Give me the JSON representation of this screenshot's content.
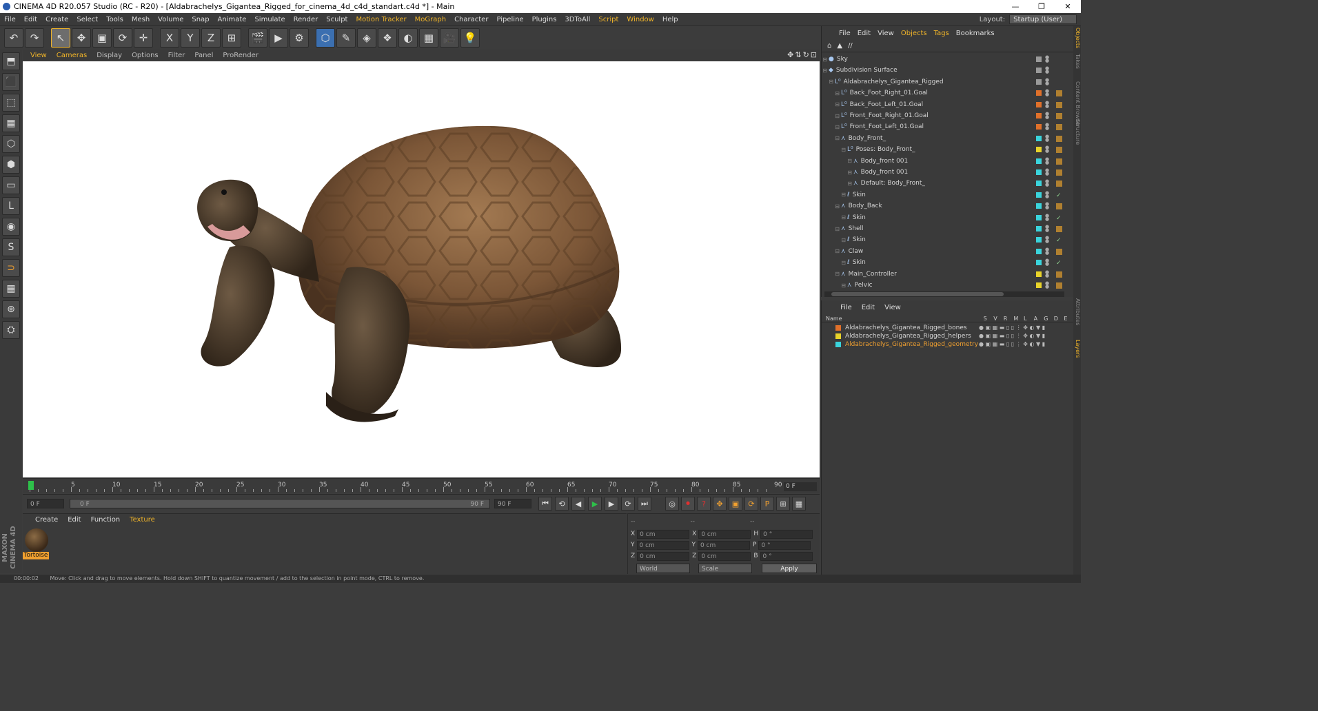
{
  "window": {
    "title": "CINEMA 4D R20.057 Studio (RC - R20) - [Aldabrachelys_Gigantea_Rigged_for_cinema_4d_c4d_standart.c4d *] - Main",
    "controls": [
      "—",
      "❐",
      "✕"
    ]
  },
  "menubar": {
    "items": [
      "File",
      "Edit",
      "Create",
      "Select",
      "Tools",
      "Mesh",
      "Volume",
      "Snap",
      "Animate",
      "Simulate",
      "Render",
      "Sculpt",
      "Motion Tracker",
      "MoGraph",
      "Character",
      "Pipeline",
      "Plugins",
      "3DToAll",
      "Script",
      "Window",
      "Help"
    ],
    "highlighted": [
      "Motion Tracker",
      "MoGraph",
      "Script",
      "Window"
    ],
    "layout_label": "Layout:",
    "layout_value": "Startup (User)"
  },
  "toolbar": {
    "icons": [
      "undo-icon",
      "redo-icon",
      "select-arrow-icon",
      "move-icon",
      "scale-icon",
      "rotate-icon",
      "live-select-icon",
      "x-axis-icon",
      "y-axis-icon",
      "z-axis-icon",
      "coordinate-system-icon",
      "render-view-icon",
      "render-picture-viewer-icon",
      "render-settings-icon",
      "cube-icon",
      "pen-icon",
      "subdivision-icon",
      "array-icon",
      "deformer-icon",
      "floor-icon",
      "camera-icon",
      "light-icon"
    ],
    "glyphs": [
      "↶",
      "↷",
      "↖",
      "✥",
      "▣",
      "⟳",
      "✛",
      "X",
      "Y",
      "Z",
      "⊞",
      "🎬",
      "▶",
      "⚙",
      "⬡",
      "✎",
      "◈",
      "❖",
      "◐",
      "▦",
      "🎥",
      "💡"
    ]
  },
  "viewport": {
    "menu": [
      "View",
      "Cameras",
      "Display",
      "Options",
      "Filter",
      "Panel",
      "ProRender"
    ],
    "highlighted": [
      "View",
      "Cameras"
    ],
    "nav_icons": [
      "✥",
      "⇅",
      "↻",
      "⊡"
    ]
  },
  "lefttools": {
    "glyphs": [
      "⬒",
      "⬛",
      "⬚",
      "▦",
      "⬡",
      "⬢",
      "▭",
      "L",
      "◉",
      "S",
      "⊃",
      "▦",
      "⊛",
      "⛭"
    ]
  },
  "maxon_logo": "MAXON CINEMA 4D",
  "timeline": {
    "ticks": [
      "0",
      "5",
      "10",
      "15",
      "20",
      "25",
      "30",
      "35",
      "40",
      "45",
      "50",
      "55",
      "60",
      "65",
      "70",
      "75",
      "80",
      "85",
      "90"
    ],
    "current_frame": "0 F"
  },
  "transport": {
    "start": "0 F",
    "range_start": "0 F",
    "range_end": "90 F",
    "end": "90 F",
    "buttons": [
      "⏮",
      "⟲",
      "◀",
      "▶",
      "▶",
      "⟳",
      "⏭"
    ]
  },
  "materials": {
    "menu": [
      "Create",
      "Edit",
      "Function",
      "Texture"
    ],
    "highlighted": [
      "Texture"
    ],
    "items": [
      {
        "name": "Tortoise"
      }
    ]
  },
  "coordinates": {
    "header": [
      "--",
      "--",
      "--"
    ],
    "rows": [
      {
        "a": "X",
        "av": "0 cm",
        "b": "X",
        "bv": "0 cm",
        "c": "H",
        "cv": "0 °"
      },
      {
        "a": "Y",
        "av": "0 cm",
        "b": "Y",
        "bv": "0 cm",
        "c": "P",
        "cv": "0 °"
      },
      {
        "a": "Z",
        "av": "0 cm",
        "b": "Z",
        "bv": "0 cm",
        "c": "B",
        "cv": "0 °"
      }
    ],
    "mode": "World",
    "scale": "Scale",
    "apply": "Apply"
  },
  "objects_panel": {
    "menu": [
      "File",
      "Edit",
      "View",
      "Objects",
      "Tags",
      "Bookmarks"
    ],
    "highlighted": [
      "Objects",
      "Tags"
    ],
    "path": "//",
    "rows": [
      {
        "name": "Sky",
        "depth": 0,
        "icon": "●",
        "color": "#9a9a9a"
      },
      {
        "name": "Subdivision Surface",
        "depth": 0,
        "icon": "◆",
        "color": "#9a9a9a"
      },
      {
        "name": "Aldabrachelys_Gigantea_Rigged",
        "depth": 1,
        "icon": "L⁰",
        "color": "#9a9a9a"
      },
      {
        "name": "Back_Foot_Right_01.Goal",
        "depth": 2,
        "icon": "L⁰",
        "color": "#e0702a"
      },
      {
        "name": "Back_Foot_Left_01.Goal",
        "depth": 2,
        "icon": "L⁰",
        "color": "#e0702a"
      },
      {
        "name": "Front_Foot_Right_01.Goal",
        "depth": 2,
        "icon": "L⁰",
        "color": "#e0702a"
      },
      {
        "name": "Front_Foot_Left_01.Goal",
        "depth": 2,
        "icon": "L⁰",
        "color": "#e0702a"
      },
      {
        "name": "Body_Front_",
        "depth": 2,
        "icon": "⋏",
        "color": "#3ad4dc"
      },
      {
        "name": "Poses: Body_Front_",
        "depth": 3,
        "icon": "L⁰",
        "color": "#e8d32a"
      },
      {
        "name": "Body_front 001",
        "depth": 4,
        "icon": "⋏",
        "color": "#3ad4dc"
      },
      {
        "name": "Body_front 001",
        "depth": 4,
        "icon": "⋏",
        "color": "#3ad4dc"
      },
      {
        "name": "Default: Body_Front_",
        "depth": 4,
        "icon": "⋏",
        "color": "#3ad4dc"
      },
      {
        "name": "Skin",
        "depth": 3,
        "icon": "ℓ",
        "color": "#3ad4dc"
      },
      {
        "name": "Body_Back",
        "depth": 2,
        "icon": "⋏",
        "color": "#3ad4dc"
      },
      {
        "name": "Skin",
        "depth": 3,
        "icon": "ℓ",
        "color": "#3ad4dc"
      },
      {
        "name": "Shell",
        "depth": 2,
        "icon": "⋏",
        "color": "#3ad4dc"
      },
      {
        "name": "Skin",
        "depth": 3,
        "icon": "ℓ",
        "color": "#3ad4dc"
      },
      {
        "name": "Claw",
        "depth": 2,
        "icon": "⋏",
        "color": "#3ad4dc"
      },
      {
        "name": "Skin",
        "depth": 3,
        "icon": "ℓ",
        "color": "#3ad4dc"
      },
      {
        "name": "Main_Controller",
        "depth": 2,
        "icon": "⋏",
        "color": "#e8d32a"
      },
      {
        "name": "Pelvic",
        "depth": 3,
        "icon": "⋏",
        "color": "#e8d32a"
      }
    ]
  },
  "layers_panel": {
    "menu": [
      "File",
      "Edit",
      "View"
    ],
    "columns": [
      "Name",
      "S",
      "V",
      "R",
      "M",
      "L",
      "A",
      "G",
      "D",
      "E",
      "X"
    ],
    "rows": [
      {
        "name": "Aldabrachelys_Gigantea_Rigged_bones",
        "color": "#e0702a",
        "active": false
      },
      {
        "name": "Aldabrachelys_Gigantea_Rigged_helpers",
        "color": "#e8d32a",
        "active": false
      },
      {
        "name": "Aldabrachelys_Gigantea_Rigged_geometry",
        "color": "#3ad4dc",
        "active": true
      }
    ]
  },
  "right_tabs": [
    "Objects",
    "Takes",
    "Content Browser",
    "Structure",
    "Attributes",
    "Layers"
  ],
  "status": {
    "time": "00:00:02",
    "message": "Move: Click and drag to move elements. Hold down SHIFT to quantize movement / add to the selection in point mode, CTRL to remove."
  }
}
